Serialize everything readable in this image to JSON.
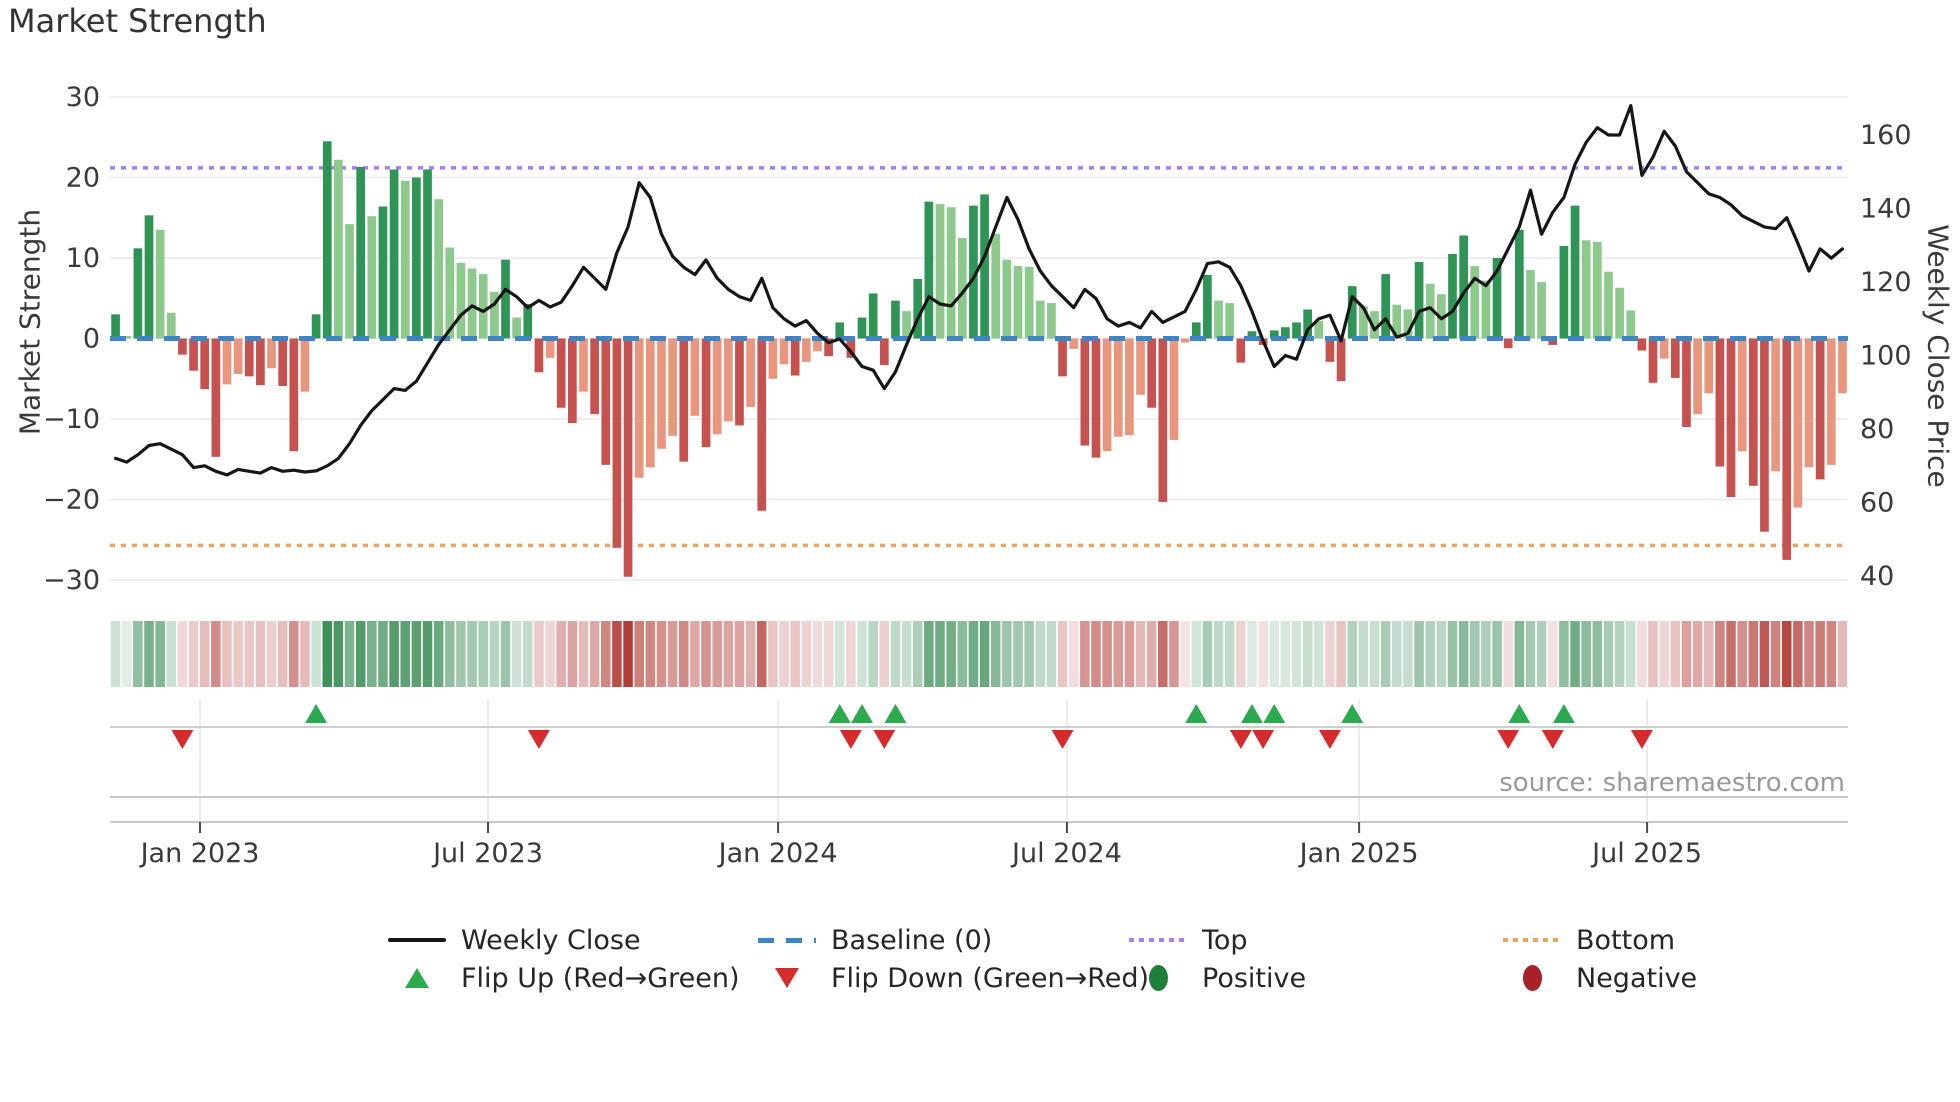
{
  "title": "Market Strength",
  "source": "source: sharemaestro.com",
  "axes": {
    "left_label": "Market Strength",
    "right_label": "Weekly Close Price"
  },
  "legend": {
    "items": [
      {
        "label": "Weekly Close"
      },
      {
        "label": "Baseline (0)"
      },
      {
        "label": "Top"
      },
      {
        "label": "Bottom"
      },
      {
        "label": "Flip Up (Red→Green)"
      },
      {
        "label": "Flip Down (Green→Red)"
      },
      {
        "label": "Positive"
      },
      {
        "label": "Negative"
      }
    ]
  },
  "colors": {
    "bar_pos_dark": "#2e9556",
    "bar_pos_light": "#8dc88c",
    "bar_neg_dark": "#c65250",
    "bar_neg_light": "#e8977e",
    "baseline": "#3d85c6",
    "top_line": "#a97ded",
    "bottom_line": "#f0a35e",
    "price_line": "#161616",
    "grid": "#e9e9f1",
    "heat_pos": "#1e7c3e",
    "heat_neg": "#b23a34",
    "marker_up": "#2bab4e",
    "marker_down": "#d62b2b",
    "axis_text": "#3a3a3a",
    "row_line": "#c9c9c9",
    "vgrid": "#e8e8ee",
    "tick": "#4a4a4a"
  },
  "chart_data": {
    "type": "combo",
    "title": "Market Strength",
    "ylabel_left": "Market Strength",
    "ylabel_right": "Weekly Close Price",
    "ylim_left": [
      -31,
      34.6
    ],
    "grid": true,
    "legend_position": "bottom",
    "baseline": 0,
    "top_line": 21.2,
    "bottom_line": -25.7,
    "left_ticks": [
      30,
      20,
      10,
      0,
      -10,
      -20,
      -30
    ],
    "right_ticks": [
      160,
      140,
      120,
      100,
      80,
      60,
      40
    ],
    "x_ticks": [
      {
        "label": "Jan 2023",
        "frac": 0.0518
      },
      {
        "label": "Jul 2023",
        "frac": 0.2175
      },
      {
        "label": "Jan 2024",
        "frac": 0.3844
      },
      {
        "label": "Jul 2024",
        "frac": 0.5506
      },
      {
        "label": "Jan 2025",
        "frac": 0.7187
      },
      {
        "label": "Jul 2025",
        "frac": 0.8844
      }
    ],
    "series": [
      {
        "name": "Market Strength (weekly bars)",
        "values": [
          3,
          0.3,
          11.2,
          15.3,
          13.5,
          3.2,
          -2,
          -4,
          -6.3,
          -14.7,
          -5.7,
          -4.4,
          -4.7,
          -5.8,
          -3.7,
          -5.9,
          -14,
          -6.6,
          3,
          24.5,
          22.2,
          14.2,
          21.3,
          15.2,
          16.4,
          21,
          19.6,
          20,
          21,
          17.3,
          11.3,
          9.4,
          8.7,
          8,
          5.8,
          9.8,
          2.6,
          4.3,
          -4.2,
          -2.4,
          -8.6,
          -10.5,
          -6.6,
          -9.4,
          -15.7,
          -26,
          -29.6,
          -17.3,
          -16,
          -13.7,
          -12.1,
          -15.3,
          -9.6,
          -13.5,
          -11.9,
          -10.3,
          -10.8,
          -8.5,
          -21.4,
          -5,
          -3.2,
          -4.6,
          -2.9,
          -1.6,
          -2.2,
          2,
          -2.4,
          2.6,
          5.6,
          -3.3,
          4.7,
          3.4,
          7.4,
          17,
          16.7,
          16.3,
          12.5,
          16.5,
          17.9,
          13,
          9.8,
          9,
          8.9,
          4.7,
          4.4,
          -4.7,
          -1.3,
          -13.3,
          -14.8,
          -14,
          -12.2,
          -12,
          -7,
          -8.6,
          -20.3,
          -12.6,
          -0.5,
          2,
          7.9,
          4.7,
          4.4,
          -3,
          0.9,
          -0.8,
          1,
          1.4,
          2,
          3.6,
          2.2,
          -2.9,
          -5.3,
          6.5,
          4,
          3.4,
          8,
          4.2,
          3.6,
          9.5,
          6.8,
          5.5,
          10.5,
          12.8,
          9,
          7.2,
          10,
          -1.2,
          13.5,
          8.5,
          7,
          -0.8,
          11.5,
          16.5,
          12.2,
          12,
          8.3,
          6.3,
          3.5,
          -1.5,
          -5.5,
          -2.5,
          -4.9,
          -11,
          -9.4,
          -6.8,
          -15.9,
          -19.7,
          -14,
          -18.3,
          -24,
          -16.5,
          -27.5,
          -21,
          -16,
          -17.5,
          -15.7,
          -6.8
        ]
      },
      {
        "name": "Weekly Close (price, right axis)",
        "values": [
          72,
          71,
          73,
          75.5,
          76,
          74.5,
          73,
          69.5,
          70,
          68.5,
          67.5,
          69,
          68.5,
          68,
          69.5,
          68.5,
          68.8,
          68.3,
          68.6,
          70,
          72,
          76,
          81,
          85,
          88,
          91,
          90.5,
          93,
          98,
          103,
          107,
          111,
          113.5,
          112,
          114,
          118,
          116,
          113,
          115,
          113.2,
          114.5,
          119,
          124,
          121,
          118,
          128,
          135,
          147,
          143,
          133,
          127,
          124,
          122,
          126,
          121,
          118,
          116,
          115,
          121,
          113,
          110,
          108,
          109.5,
          106,
          103.5,
          104.5,
          101,
          97,
          96,
          91,
          95.5,
          103,
          110,
          116,
          114,
          113.5,
          117,
          121,
          127,
          135,
          143,
          137,
          129,
          123,
          119,
          116,
          113,
          118,
          115.5,
          110,
          108,
          109,
          107.5,
          112,
          109,
          110.5,
          112,
          118,
          125,
          125.5,
          124,
          119,
          112,
          104,
          97,
          100,
          99,
          107,
          110,
          111,
          104,
          116,
          113,
          107,
          110,
          105,
          106,
          112,
          113,
          110,
          112,
          117,
          121,
          119,
          123,
          129,
          135,
          145,
          133,
          139,
          143,
          152,
          158,
          162,
          160,
          160,
          168,
          149,
          154,
          161,
          157,
          150,
          147,
          144,
          143,
          141,
          138,
          136.5,
          135,
          134.5,
          137.5,
          130.5,
          123,
          129,
          126.5,
          129
        ]
      }
    ],
    "flips_up_week_index": [
      18,
      65,
      67,
      70,
      97,
      102,
      104,
      111,
      126,
      130
    ],
    "flips_down_week_index": [
      6,
      38,
      66,
      69,
      85,
      101,
      103,
      109,
      125,
      129,
      137
    ],
    "heatmap": "color strip below chart encodes same weekly bar values (green positive / red negative, darker = larger magnitude)"
  }
}
